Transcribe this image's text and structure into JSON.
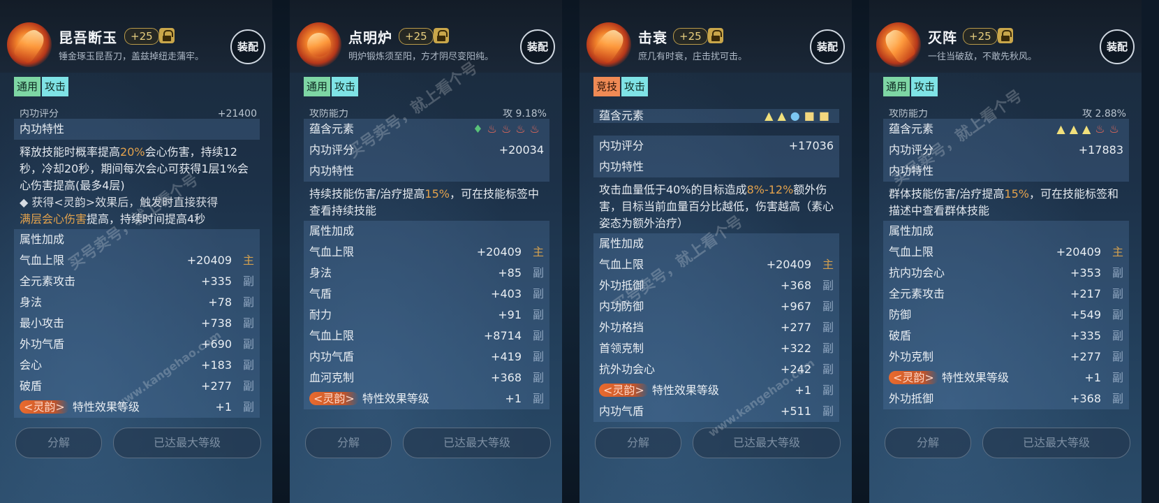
{
  "panels": [
    {
      "title": "昆吾断玉",
      "level": "+25",
      "subtitle": "锤金琢玉昆吾刀，盖兹掉纽走蒲牢。",
      "equip": "装配",
      "tags": [
        "通用",
        "攻击"
      ],
      "top_cut": {
        "label": "内功评分",
        "value": "+21400"
      },
      "trait_heading": "内功特性",
      "desc_parts": [
        "释放技能时概率提高",
        "20%",
        "会心伤害，持续12秒，冷却20秒，期间每次会心可获得1层1%会心伤害提高(最多4层)"
      ],
      "bullet_parts": [
        "◆ 获得<灵韵>效果后，触发时直接获得",
        "满层会心伤害",
        "提高，持续时间提高4秒"
      ],
      "attr_heading": "属性加成",
      "attrs": [
        {
          "label": "气血上限",
          "value": "+20409",
          "tail": "主"
        },
        {
          "label": "全元素攻击",
          "value": "+335",
          "tail": "副"
        },
        {
          "label": "身法",
          "value": "+78",
          "tail": "副"
        },
        {
          "label": "最小攻击",
          "value": "+738",
          "tail": "副"
        },
        {
          "label": "外功气盾",
          "value": "+690",
          "tail": "副"
        },
        {
          "label": "会心",
          "value": "+183",
          "tail": "副"
        },
        {
          "label": "破盾",
          "value": "+277",
          "tail": "副"
        }
      ],
      "lingyun": {
        "tag": "<灵韵>",
        "label": "特性效果等级",
        "value": "+1",
        "tail": "副"
      },
      "btn_decompose": "分解",
      "btn_max": "已达最大等级"
    },
    {
      "title": "点明炉",
      "level": "+25",
      "subtitle": "明炉锻炼须至阳，方才阴尽变阳纯。",
      "equip": "装配",
      "tags": [
        "通用",
        "攻击"
      ],
      "top_cut": {
        "label": "攻防能力",
        "value": "攻 9.18%"
      },
      "element_label": "蕴含元素",
      "elements": [
        "leaf",
        "fire",
        "fire",
        "fire",
        "fire"
      ],
      "score_label": "内功评分",
      "score": "+20034",
      "trait_heading": "内功特性",
      "desc_parts": [
        "持续技能伤害/治疗提高",
        "15%",
        "，可在技能标签中查看持续技能"
      ],
      "attr_heading": "属性加成",
      "attrs": [
        {
          "label": "气血上限",
          "value": "+20409",
          "tail": "主"
        },
        {
          "label": "身法",
          "value": "+85",
          "tail": "副"
        },
        {
          "label": "气盾",
          "value": "+403",
          "tail": "副"
        },
        {
          "label": "耐力",
          "value": "+91",
          "tail": "副"
        },
        {
          "label": "气血上限",
          "value": "+8714",
          "tail": "副"
        },
        {
          "label": "内功气盾",
          "value": "+419",
          "tail": "副"
        },
        {
          "label": "血河克制",
          "value": "+368",
          "tail": "副"
        }
      ],
      "lingyun": {
        "tag": "<灵韵>",
        "label": "特性效果等级",
        "value": "+1",
        "tail": "副"
      },
      "btn_decompose": "分解",
      "btn_max": "已达最大等级"
    },
    {
      "title": "击衰",
      "level": "+25",
      "subtitle": "庶几有时衰，庄击扰可击。",
      "equip": "装配",
      "tags": [
        "竞技",
        "攻击"
      ],
      "element_label": "蕴含元素",
      "elements": [
        "tri",
        "tri",
        "drop",
        "blk",
        "blk"
      ],
      "score_label": "内功评分",
      "score": "+17036",
      "trait_heading": "内功特性",
      "desc_parts": [
        "攻击血量低于40%的目标造成",
        "8%-12%",
        "额外伤害，目标当前血量百分比越低，伤害越高（素心姿态为额外治疗）"
      ],
      "attr_heading": "属性加成",
      "attrs": [
        {
          "label": "气血上限",
          "value": "+20409",
          "tail": "主"
        },
        {
          "label": "外功抵御",
          "value": "+368",
          "tail": "副"
        },
        {
          "label": "内功防御",
          "value": "+967",
          "tail": "副"
        },
        {
          "label": "外功格挡",
          "value": "+277",
          "tail": "副"
        },
        {
          "label": "首领克制",
          "value": "+322",
          "tail": "副"
        },
        {
          "label": "抗外功会心",
          "value": "+242",
          "tail": "副"
        }
      ],
      "lingyun": {
        "tag": "<灵韵>",
        "label": "特性效果等级",
        "value": "+1",
        "tail": "副"
      },
      "after_ling": {
        "label": "内功气盾",
        "value": "+511",
        "tail": "副"
      },
      "btn_decompose": "分解",
      "btn_max": "已达最大等级"
    },
    {
      "title": "灭阵",
      "level": "+25",
      "subtitle": "一往当破敌，不敢先秋风。",
      "equip": "装配",
      "tags": [
        "通用",
        "攻击"
      ],
      "top_cut": {
        "label": "攻防能力",
        "value": "攻 2.88%"
      },
      "element_label": "蕴含元素",
      "elements": [
        "tri",
        "tri",
        "tri",
        "fire",
        "fire"
      ],
      "score_label": "内功评分",
      "score": "+17883",
      "trait_heading": "内功特性",
      "desc_parts": [
        "群体技能伤害/治疗提高",
        "15%",
        "，可在技能标签和描述中查看群体技能"
      ],
      "attr_heading": "属性加成",
      "attrs": [
        {
          "label": "气血上限",
          "value": "+20409",
          "tail": "主"
        },
        {
          "label": "抗内功会心",
          "value": "+353",
          "tail": "副"
        },
        {
          "label": "全元素攻击",
          "value": "+217",
          "tail": "副"
        },
        {
          "label": "防御",
          "value": "+549",
          "tail": "副"
        },
        {
          "label": "破盾",
          "value": "+335",
          "tail": "副"
        },
        {
          "label": "外功克制",
          "value": "+277",
          "tail": "副"
        }
      ],
      "lingyun": {
        "tag": "<灵韵>",
        "label": "特性效果等级",
        "value": "+1",
        "tail": "副"
      },
      "after_ling": {
        "label": "外功抵御",
        "value": "+368",
        "tail": "副"
      },
      "btn_decompose": "分解",
      "btn_max": "已达最大等级"
    }
  ],
  "watermark": {
    "text": "买号卖号，就上看个号",
    "url": "www.kangehao.com"
  },
  "colors": {
    "accent_gold": "#e3a24c",
    "tag_green": "#7ed6a4",
    "tag_cyan": "#7fe3e6",
    "tag_orange": "#ef8a55",
    "lingyun_orange": "#e96b2e"
  }
}
